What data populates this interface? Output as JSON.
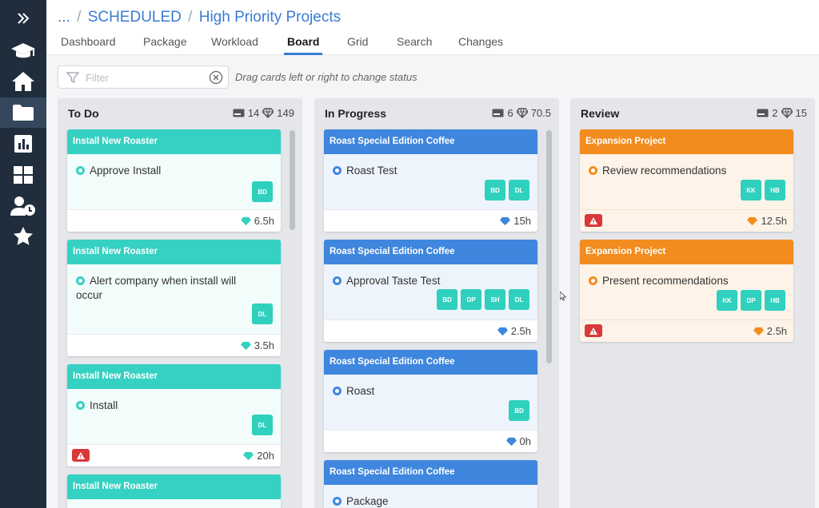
{
  "colors": {
    "sidebar_bg": "#1f2d3d",
    "link_blue": "#3a7bd5",
    "teal": "#35d1c2",
    "blue": "#3f86de",
    "orange": "#f28c1e",
    "avatar_teal": "#2fd0be",
    "warning_red": "#d93838"
  },
  "sidebar": {
    "items": [
      {
        "icon": "expand-chevrons-icon"
      },
      {
        "icon": "graduation-cap-icon"
      },
      {
        "icon": "home-icon"
      },
      {
        "icon": "folder-icon",
        "active": true
      },
      {
        "icon": "bar-chart-icon"
      },
      {
        "icon": "grid-icon"
      },
      {
        "icon": "user-clock-icon"
      },
      {
        "icon": "star-icon"
      }
    ]
  },
  "breadcrumb": {
    "ellipsis": "...",
    "separator": "/",
    "parent": "SCHEDULED",
    "current": "High Priority Projects"
  },
  "tabs": [
    {
      "label": "Dashboard"
    },
    {
      "label": "Package"
    },
    {
      "label": "Workload"
    },
    {
      "label": "Board",
      "active": true
    },
    {
      "label": "Grid"
    },
    {
      "label": "Search"
    },
    {
      "label": "Changes"
    }
  ],
  "filter": {
    "placeholder": "Filter",
    "value": "",
    "hint": "Drag cards left or right to change status"
  },
  "columns": [
    {
      "title": "To Do",
      "card_count": "14",
      "hours_total": "149",
      "cards": [
        {
          "project": "Install New Roaster",
          "task": "Approve Install",
          "assignees": [
            "BD"
          ],
          "hours": "6.5h",
          "warning": false
        },
        {
          "project": "Install New Roaster",
          "task": "Alert company when install will occur",
          "assignees": [
            "DL"
          ],
          "hours": "3.5h",
          "warning": false
        },
        {
          "project": "Install New Roaster",
          "task": "Install",
          "assignees": [
            "DL"
          ],
          "hours": "20h",
          "warning": true
        },
        {
          "project": "Install New Roaster",
          "task": "",
          "assignees": [],
          "hours": "",
          "warning": false
        }
      ]
    },
    {
      "title": "In Progress",
      "card_count": "6",
      "hours_total": "70.5",
      "cards": [
        {
          "project": "Roast Special Edition Coffee",
          "task": "Roast Test",
          "assignees": [
            "BD",
            "DL"
          ],
          "hours": "15h",
          "warning": false
        },
        {
          "project": "Roast Special Edition Coffee",
          "task": "Approval Taste Test",
          "assignees": [
            "BD",
            "DP",
            "SH",
            "DL"
          ],
          "hours": "2.5h",
          "warning": false
        },
        {
          "project": "Roast Special Edition Coffee",
          "task": "Roast",
          "assignees": [
            "BD"
          ],
          "hours": "0h",
          "warning": false
        },
        {
          "project": "Roast Special Edition Coffee",
          "task": "Package",
          "assignees": [],
          "hours": "",
          "warning": false
        }
      ]
    },
    {
      "title": "Review",
      "card_count": "2",
      "hours_total": "15",
      "cards": [
        {
          "project": "Expansion Project",
          "task": "Review recommendations",
          "assignees": [
            "KK",
            "HB"
          ],
          "hours": "12.5h",
          "warning": true
        },
        {
          "project": "Expansion Project",
          "task": "Present recommendations",
          "assignees": [
            "KK",
            "DP",
            "HB"
          ],
          "hours": "2.5h",
          "warning": true
        }
      ]
    }
  ]
}
